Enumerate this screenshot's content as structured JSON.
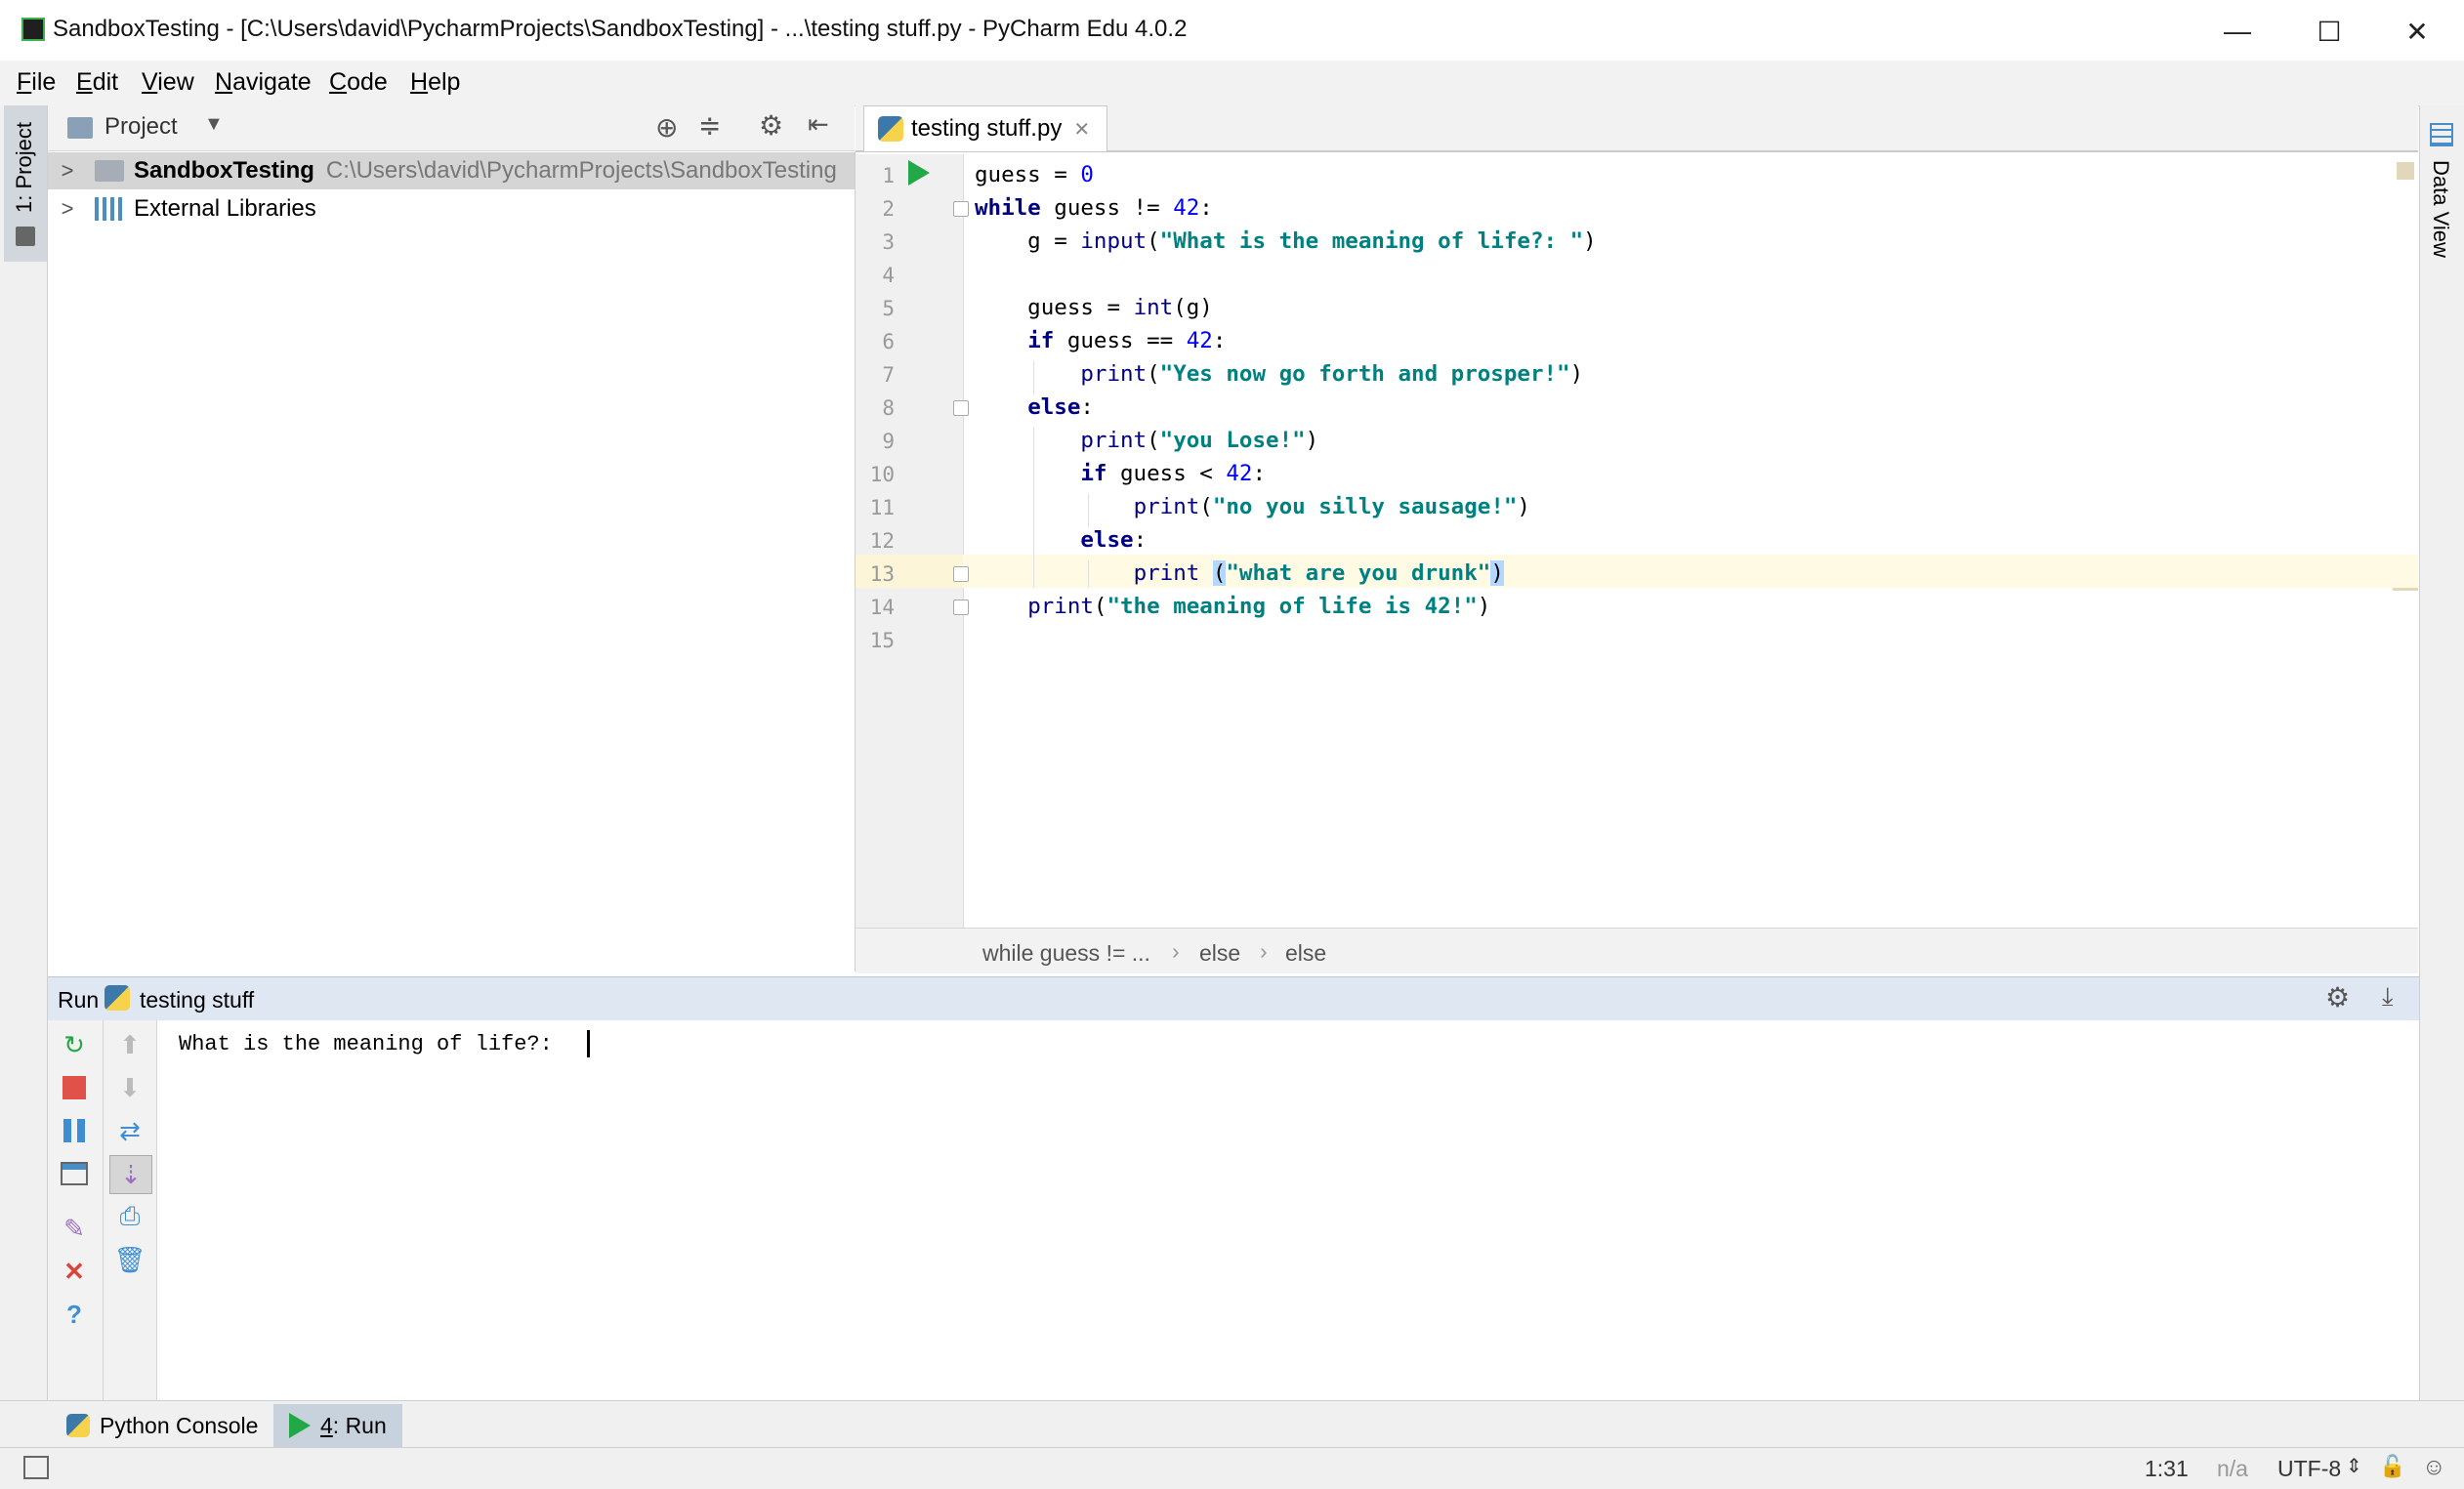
{
  "window": {
    "title": "SandboxTesting - [C:\\Users\\david\\PycharmProjects\\SandboxTesting] - ...\\testing stuff.py - PyCharm Edu 4.0.2",
    "minimize_glyph": "—",
    "maximize_glyph": "☐",
    "close_glyph": "✕"
  },
  "menu": {
    "items": [
      {
        "key": "F",
        "rest": "ile"
      },
      {
        "key": "E",
        "rest": "dit"
      },
      {
        "key": "V",
        "rest": "iew"
      },
      {
        "key": "N",
        "rest": "avigate"
      },
      {
        "key": "C",
        "rest": "ode"
      },
      {
        "key": "H",
        "rest": "elp"
      }
    ]
  },
  "left_strip": {
    "project_tab": "1: Project"
  },
  "project_panel": {
    "title": "Project",
    "root": {
      "name": "SandboxTesting",
      "path": "C:\\Users\\david\\PycharmProjects\\SandboxTesting"
    },
    "libraries": "External Libraries"
  },
  "editor": {
    "tab_label": "testing stuff.py",
    "line_numbers": [
      "1",
      "2",
      "3",
      "4",
      "5",
      "6",
      "7",
      "8",
      "9",
      "10",
      "11",
      "12",
      "13",
      "14",
      "15"
    ],
    "breadcrumb": [
      "while guess != ...",
      "else",
      "else"
    ]
  },
  "right_strip": {
    "data_view": "Data View"
  },
  "run_panel": {
    "label": "Run",
    "config": "testing stuff",
    "output": "What is the meaning of life?: "
  },
  "bottom_tabs": {
    "python_console": "Python Console",
    "run_key": "4",
    "run_rest": ": Run"
  },
  "status": {
    "position": "1:31",
    "na": "n/a",
    "encoding": "UTF-8"
  },
  "colors": {
    "keyword": "#000080",
    "string": "#008080",
    "number": "#0000ff",
    "current_line": "#fffae3",
    "run_header": "#dfe7f2"
  }
}
